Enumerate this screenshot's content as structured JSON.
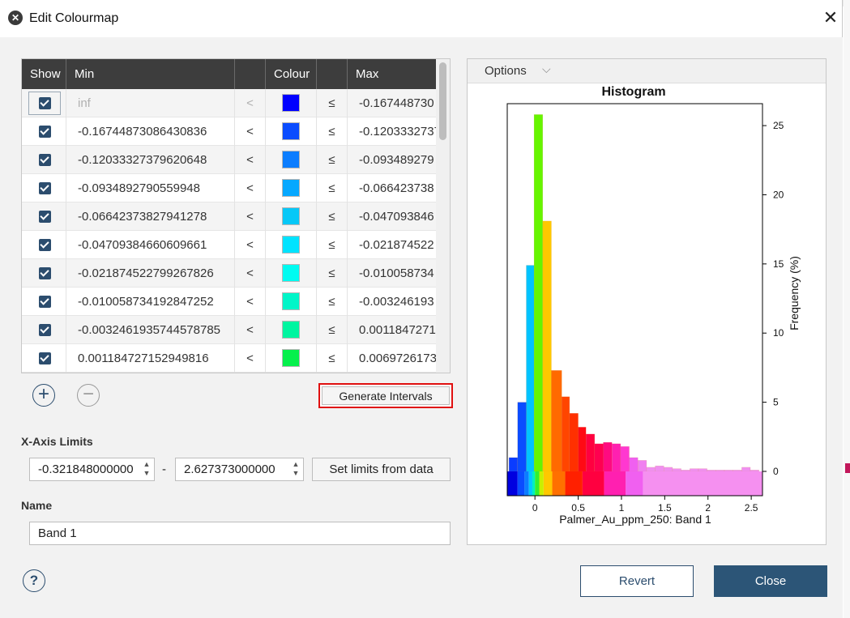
{
  "window": {
    "title": "Edit Colourmap",
    "close_glyph": "✕"
  },
  "table": {
    "headers": {
      "show": "Show",
      "min": "Min",
      "colour": "Colour",
      "max": "Max"
    },
    "rows": [
      {
        "min": "inf",
        "lt": "<",
        "colour": "#0000ff",
        "le": "≤",
        "max": "-0.167448730",
        "checked": true,
        "disabled": true
      },
      {
        "min": "-0.16744873086430836",
        "lt": "<",
        "colour": "#0a4cff",
        "le": "≤",
        "max": "-0.1203332737",
        "checked": true
      },
      {
        "min": "-0.12033327379620648",
        "lt": "<",
        "colour": "#0b7dff",
        "le": "≤",
        "max": "-0.093489279",
        "checked": true
      },
      {
        "min": "-0.0934892790559948",
        "lt": "<",
        "colour": "#06a8ff",
        "le": "≤",
        "max": "-0.066423738",
        "checked": true
      },
      {
        "min": "-0.06642373827941278",
        "lt": "<",
        "colour": "#06c8f7",
        "le": "≤",
        "max": "-0.047093846",
        "checked": true
      },
      {
        "min": "-0.04709384660609661",
        "lt": "<",
        "colour": "#00e3ff",
        "le": "≤",
        "max": "-0.021874522",
        "checked": true
      },
      {
        "min": "-0.021874522799267826",
        "lt": "<",
        "colour": "#00fbf1",
        "le": "≤",
        "max": "-0.010058734",
        "checked": true
      },
      {
        "min": "-0.010058734192847252",
        "lt": "<",
        "colour": "#00f5c8",
        "le": "≤",
        "max": "-0.003246193",
        "checked": true
      },
      {
        "min": "-0.0032461935744578785",
        "lt": "<",
        "colour": "#00f5a0",
        "le": "≤",
        "max": "0.0011847271",
        "checked": true
      },
      {
        "min": "0.001184727152949816",
        "lt": "<",
        "colour": "#06f04c",
        "le": "≤",
        "max": "0.0069726173",
        "checked": true
      }
    ]
  },
  "controls": {
    "add_glyph": "+",
    "remove_glyph": "−",
    "generate_intervals": "Generate Intervals",
    "xaxis_label": "X-Axis Limits",
    "xaxis_min": "-0.321848000000",
    "xaxis_max": "2.627373000000",
    "dash": "-",
    "set_limits": "Set limits from data",
    "name_label": "Name",
    "name_value": "Band 1",
    "spin_up": "▲",
    "spin_down": "▼"
  },
  "plot_panel": {
    "options_label": "Options",
    "options_chevron": "⌵"
  },
  "chart_data": {
    "type": "bar",
    "title": "Histogram",
    "xlabel": "Palmer_Au_ppm_250: Band 1",
    "ylabel": "Frequency (%)",
    "xlim": [
      -0.32,
      2.63
    ],
    "ylim": [
      0,
      26
    ],
    "x_ticks": [
      "0",
      "0.5",
      "1",
      "1.5",
      "2",
      "2.5"
    ],
    "x_tick_values": [
      0,
      0.5,
      1,
      1.5,
      2,
      2.5
    ],
    "y_ticks": [
      "0",
      "5",
      "10",
      "15",
      "20",
      "25"
    ],
    "y_tick_values": [
      0,
      5,
      10,
      15,
      20,
      25
    ],
    "y_axis_side": "right",
    "bars": [
      {
        "x0": -0.3,
        "x1": -0.2,
        "value": 1.0,
        "color": "#0a3cff"
      },
      {
        "x0": -0.2,
        "x1": -0.1,
        "value": 5.0,
        "color": "#0a4cff"
      },
      {
        "x0": -0.1,
        "x1": -0.01,
        "value": 14.9,
        "color": "#00c3ff"
      },
      {
        "x0": -0.01,
        "x1": 0.09,
        "value": 25.8,
        "color": "#66f500"
      },
      {
        "x0": 0.09,
        "x1": 0.19,
        "value": 18.1,
        "color": "#ffc800"
      },
      {
        "x0": 0.19,
        "x1": 0.31,
        "value": 7.3,
        "color": "#ff6a00"
      },
      {
        "x0": 0.31,
        "x1": 0.4,
        "value": 5.4,
        "color": "#ff4500"
      },
      {
        "x0": 0.4,
        "x1": 0.5,
        "value": 4.2,
        "color": "#ff3000"
      },
      {
        "x0": 0.5,
        "x1": 0.59,
        "value": 3.2,
        "color": "#ff0a14"
      },
      {
        "x0": 0.59,
        "x1": 0.69,
        "value": 2.7,
        "color": "#ff0040"
      },
      {
        "x0": 0.69,
        "x1": 0.79,
        "value": 2.0,
        "color": "#ff0050"
      },
      {
        "x0": 0.79,
        "x1": 0.89,
        "value": 2.1,
        "color": "#ff0a80"
      },
      {
        "x0": 0.89,
        "x1": 0.99,
        "value": 2.0,
        "color": "#ff20b0"
      },
      {
        "x0": 0.99,
        "x1": 1.09,
        "value": 1.8,
        "color": "#ff38d0"
      },
      {
        "x0": 1.09,
        "x1": 1.19,
        "value": 1.0,
        "color": "#f060f0"
      },
      {
        "x0": 1.19,
        "x1": 1.29,
        "value": 0.8,
        "color": "#f080f0"
      },
      {
        "x0": 1.29,
        "x1": 1.39,
        "value": 0.3,
        "color": "#f090f0"
      },
      {
        "x0": 1.39,
        "x1": 1.49,
        "value": 0.4,
        "color": "#f090f0"
      },
      {
        "x0": 1.49,
        "x1": 1.59,
        "value": 0.3,
        "color": "#f090f0"
      },
      {
        "x0": 1.59,
        "x1": 1.69,
        "value": 0.2,
        "color": "#f090f0"
      },
      {
        "x0": 1.69,
        "x1": 1.79,
        "value": 0.1,
        "color": "#f090f0"
      },
      {
        "x0": 1.79,
        "x1": 1.89,
        "value": 0.2,
        "color": "#f090f0"
      },
      {
        "x0": 1.89,
        "x1": 1.99,
        "value": 0.2,
        "color": "#f090f0"
      },
      {
        "x0": 1.99,
        "x1": 2.09,
        "value": 0.1,
        "color": "#f090f0"
      },
      {
        "x0": 2.09,
        "x1": 2.19,
        "value": 0.1,
        "color": "#f090f0"
      },
      {
        "x0": 2.19,
        "x1": 2.29,
        "value": 0.1,
        "color": "#f090f0"
      },
      {
        "x0": 2.29,
        "x1": 2.39,
        "value": 0.1,
        "color": "#f090f0"
      },
      {
        "x0": 2.39,
        "x1": 2.49,
        "value": 0.3,
        "color": "#f090f0"
      },
      {
        "x0": 2.49,
        "x1": 2.59,
        "value": 0.1,
        "color": "#f090f0"
      }
    ],
    "colour_scale": [
      {
        "x0": -0.32,
        "x1": -0.2,
        "color": "#0000e0"
      },
      {
        "x0": -0.2,
        "x1": -0.12,
        "color": "#0a4cff"
      },
      {
        "x0": -0.12,
        "x1": -0.07,
        "color": "#0b7dff"
      },
      {
        "x0": -0.07,
        "x1": -0.03,
        "color": "#00c8ff"
      },
      {
        "x0": -0.03,
        "x1": 0.0,
        "color": "#00f0c0"
      },
      {
        "x0": 0.0,
        "x1": 0.05,
        "color": "#30f030"
      },
      {
        "x0": 0.05,
        "x1": 0.1,
        "color": "#c8f000"
      },
      {
        "x0": 0.1,
        "x1": 0.2,
        "color": "#ffc800"
      },
      {
        "x0": 0.2,
        "x1": 0.35,
        "color": "#ff7000"
      },
      {
        "x0": 0.35,
        "x1": 0.55,
        "color": "#ff2000"
      },
      {
        "x0": 0.55,
        "x1": 0.8,
        "color": "#ff0040"
      },
      {
        "x0": 0.8,
        "x1": 1.05,
        "color": "#ff20b0"
      },
      {
        "x0": 1.05,
        "x1": 1.25,
        "color": "#f060f0"
      },
      {
        "x0": 1.25,
        "x1": 2.63,
        "color": "#f590f0"
      }
    ]
  },
  "footer": {
    "help_glyph": "?",
    "revert": "Revert",
    "close": "Close"
  }
}
